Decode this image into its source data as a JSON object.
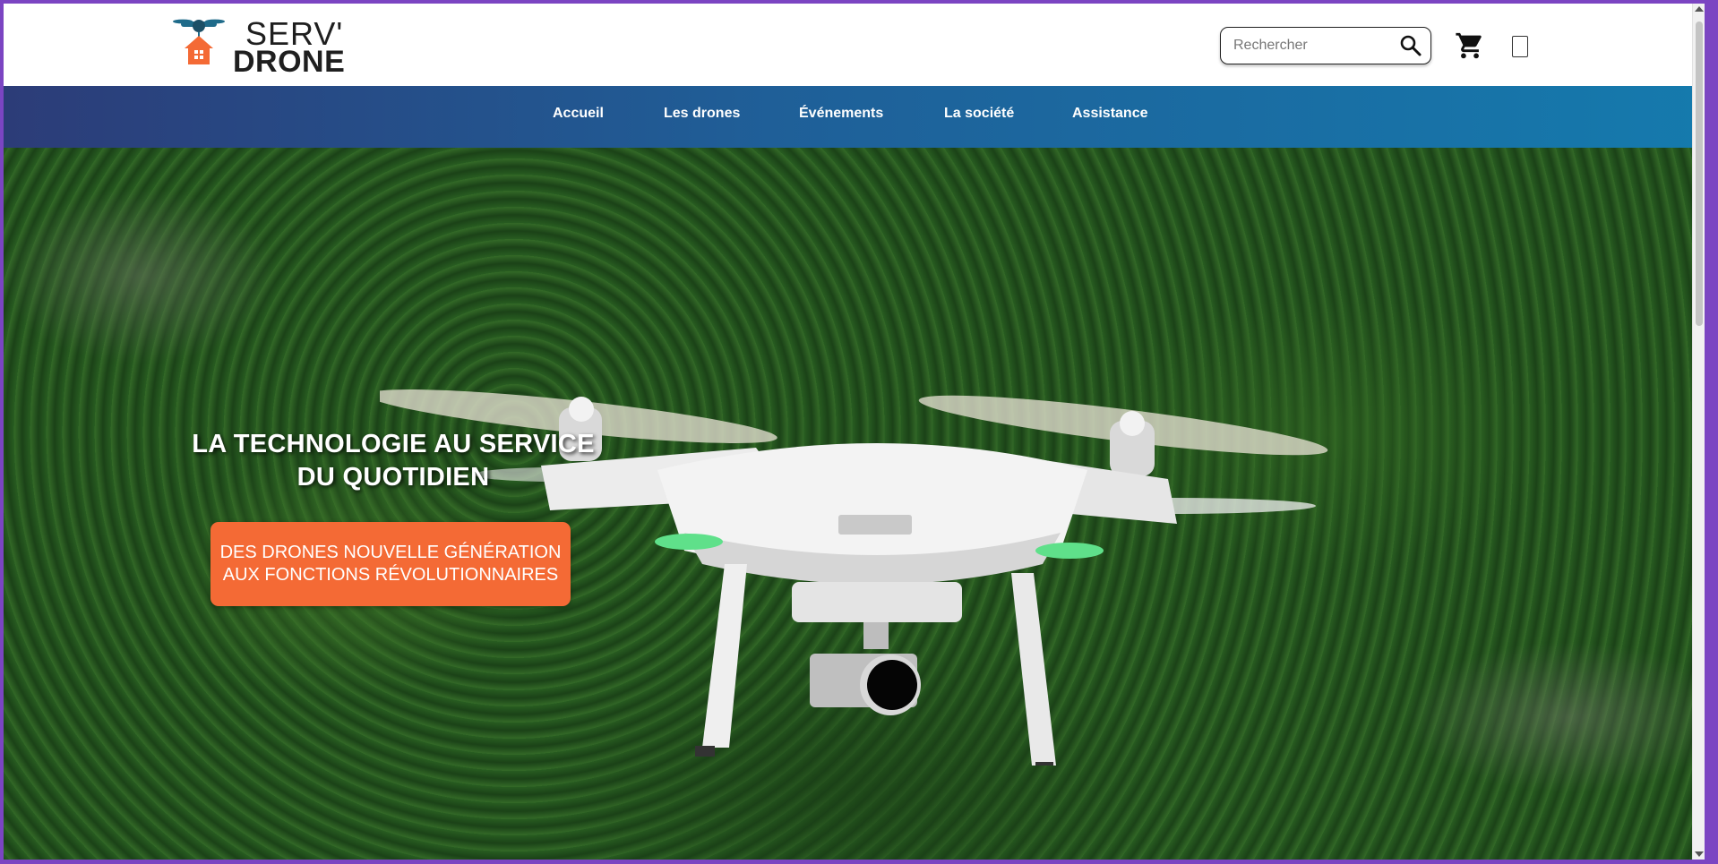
{
  "brand": {
    "line1": "SERV'",
    "line2": "DRONE",
    "accent_color": "#f46a35",
    "drone_color": "#1f6b8a"
  },
  "header": {
    "search": {
      "placeholder": "Rechercher"
    },
    "icons": {
      "search": "search-icon",
      "cart": "cart-icon",
      "account": "account-icon"
    }
  },
  "nav": {
    "items": [
      {
        "label": "Accueil"
      },
      {
        "label": "Les drones"
      },
      {
        "label": "Événements"
      },
      {
        "label": "La société"
      },
      {
        "label": "Assistance"
      }
    ],
    "gradient": [
      "#2c3c78",
      "#157aad"
    ]
  },
  "hero": {
    "title": "LA TECHNOLOGIE AU SERVICE DU QUOTIDIEN",
    "cta_line1": "DES DRONES NOUVELLE GÉNÉRATION",
    "cta_line2": "AUX FONCTIONS RÉVOLUTIONNAIRES",
    "cta_color": "#f46a35"
  }
}
